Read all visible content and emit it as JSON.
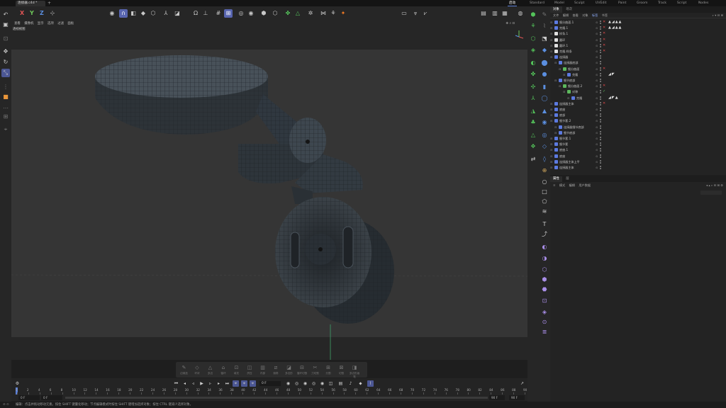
{
  "tabbar": {
    "doc_tab": "连接器.c4d *",
    "layouts": [
      "启动",
      "Standard",
      "Model",
      "Sculpt",
      "UVEdit",
      "Paint",
      "Groom",
      "Track",
      "Script",
      "Nodes"
    ]
  },
  "toolbar": {
    "axes": [
      "X",
      "Y",
      "Z"
    ],
    "axis_colors": {
      "x": "#e25555",
      "y": "#6ec85a",
      "z": "#5b8fe0"
    }
  },
  "viewport": {
    "menu": [
      "查看",
      "摄像机",
      "显示",
      "选项",
      "过滤",
      "面板"
    ],
    "label": "透视视图",
    "bg_color": "#353535"
  },
  "dock": {
    "items": [
      "边缘选",
      "环状",
      "多边",
      "循环",
      "填充",
      "挤压",
      "内部",
      "倒角",
      "多边形",
      "循环切割",
      "刀切割",
      "分割",
      "切割",
      "多边形画笔"
    ]
  },
  "timeline": {
    "current_frame": "0 F",
    "start_field": "0 F",
    "min_field": "0 F",
    "max_field": "90 F",
    "end_field": "90 F",
    "ticks": [
      "0",
      "2",
      "4",
      "6",
      "8",
      "10",
      "12",
      "14",
      "16",
      "18",
      "20",
      "22",
      "24",
      "26",
      "28",
      "30",
      "32",
      "34",
      "36",
      "38",
      "40",
      "42",
      "44",
      "46",
      "48",
      "50",
      "52",
      "54",
      "56",
      "58",
      "60",
      "62",
      "64",
      "66",
      "68",
      "70",
      "72",
      "74",
      "76",
      "78",
      "80",
      "82",
      "84",
      "86",
      "88",
      "90"
    ]
  },
  "status": {
    "text": "编辑：点击并拖动移动元素。按住 SHIFT 键量化移动；节点编辑模式时按住 SHIFT 键增加选择对象；按住 CTRL 键减少选择对象。"
  },
  "objmgr": {
    "tabs": [
      "对象",
      "场次"
    ],
    "menu": [
      "文件",
      "编辑",
      "查看",
      "对象",
      "标签",
      "书签"
    ],
    "rows": [
      {
        "name": "细分曲面.1",
        "indent": 0,
        "icon": "#5c7ae0",
        "x": "red",
        "tags": "▲◢▲▲"
      },
      {
        "name": "克隆.1",
        "indent": 0,
        "icon": "#5c7ae0",
        "x": "red",
        "tags": "▲◢▲▲"
      },
      {
        "name": "样条.1",
        "indent": 0,
        "icon": "#e0e0e0",
        "x": "red",
        "tags": ""
      },
      {
        "name": "圆环",
        "indent": 0,
        "icon": "#e0e0e0",
        "x": "red",
        "tags": ""
      },
      {
        "name": "圆环.1",
        "indent": 0,
        "icon": "#e0e0e0",
        "x": "red",
        "tags": ""
      },
      {
        "name": "克隆.样条",
        "indent": 0,
        "icon": "#e0e0e0",
        "x": "red",
        "tags": ""
      },
      {
        "name": "连接器",
        "indent": 0,
        "icon": "#5c7ae0",
        "x": "",
        "tags": ""
      },
      {
        "name": "连接器底部",
        "indent": 1,
        "icon": "#5c7ae0",
        "x": "",
        "tags": ""
      },
      {
        "name": "细分曲面",
        "indent": 2,
        "icon": "#5cb85c",
        "x": "red",
        "tags": ""
      },
      {
        "name": "克隆",
        "indent": 3,
        "icon": "#5c7ae0",
        "x": "",
        "tags": "◢◤"
      },
      {
        "name": "细节底部",
        "indent": 1,
        "icon": "#5c7ae0",
        "x": "",
        "tags": ""
      },
      {
        "name": "细分曲面.2",
        "indent": 2,
        "icon": "#5cb85c",
        "x": "red",
        "tags": ""
      },
      {
        "name": "对称",
        "indent": 3,
        "icon": "#5cb85c",
        "x": "green",
        "tags": ""
      },
      {
        "name": "克隆",
        "indent": 4,
        "icon": "#5c7ae0",
        "x": "",
        "tags": "◢◤▲"
      },
      {
        "name": "连接器主体",
        "indent": 0,
        "icon": "#5c7ae0",
        "x": "red",
        "tags": ""
      },
      {
        "name": "底座",
        "indent": 0,
        "icon": "#5c7ae0",
        "x": "",
        "tags": ""
      },
      {
        "name": "底部",
        "indent": 0,
        "icon": "#5c7ae0",
        "x": "",
        "tags": ""
      },
      {
        "name": "细节套.2",
        "indent": 0,
        "icon": "#5c7ae0",
        "x": "",
        "tags": ""
      },
      {
        "name": "连接器细节底部",
        "indent": 1,
        "icon": "#5c7ae0",
        "x": "",
        "tags": ""
      },
      {
        "name": "细节底部",
        "indent": 1,
        "icon": "#5c7ae0",
        "x": "",
        "tags": ""
      },
      {
        "name": "细节套.1",
        "indent": 0,
        "icon": "#5c7ae0",
        "x": "",
        "tags": ""
      },
      {
        "name": "细节套",
        "indent": 0,
        "icon": "#5c7ae0",
        "x": "",
        "tags": ""
      },
      {
        "name": "底座.1",
        "indent": 0,
        "icon": "#5c7ae0",
        "x": "",
        "tags": ""
      },
      {
        "name": "底座",
        "indent": 0,
        "icon": "#5c7ae0",
        "x": "",
        "tags": ""
      },
      {
        "name": "连接器主体上平",
        "indent": 0,
        "icon": "#5c7ae0",
        "x": "",
        "tags": ""
      },
      {
        "name": "连接器主体",
        "indent": 0,
        "icon": "#5c7ae0",
        "x": "",
        "tags": ""
      }
    ]
  },
  "attrmgr": {
    "tabs": [
      "属性",
      "层"
    ],
    "menu": [
      "模式",
      "编辑",
      "用户数据"
    ]
  }
}
